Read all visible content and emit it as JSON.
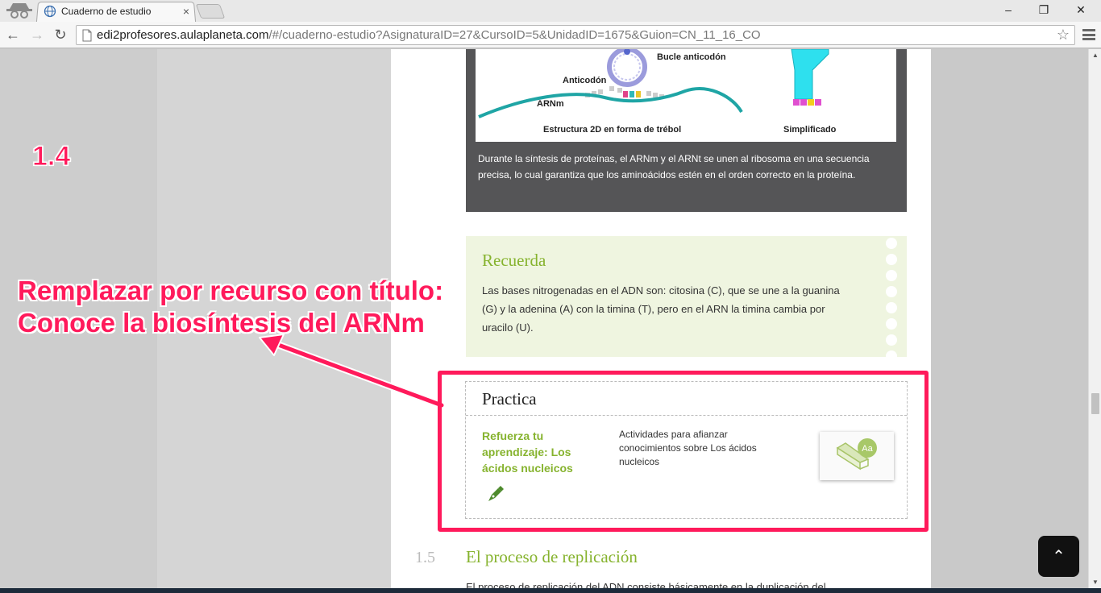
{
  "browser": {
    "tab_title": "Cuaderno de estudio",
    "url_host": "edi2profesores.aulaplaneta.com",
    "url_path": "/#/cuaderno-estudio?AsignaturaID=27&CursoID=5&UnidadID=1675&Guion=CN_11_16_CO",
    "minimize": "–",
    "restore": "❐",
    "close": "✕",
    "back": "←",
    "forward": "→",
    "reload": "↻",
    "bookmark": "☆"
  },
  "figure": {
    "labels": {
      "bucle": "Bucle anticodón",
      "anticodon": "Anticodón",
      "arnm": "ARNm",
      "estructura": "Estructura 2D en forma de trébol",
      "simplificado": "Simplificado"
    },
    "caption": "Durante la síntesis de proteínas, el ARNm y el ARNt se unen al ribosoma en una secuencia precisa, lo cual garantiza que los aminoácidos estén en el orden correcto en la proteína."
  },
  "recuerda": {
    "title": "Recuerda",
    "text": "Las bases nitrogenadas en el ADN son: citosina (C), que se une a la guanina (G) y la adenina (A) con la timina (T), pero en el ARN la timina cambia por uracilo (U)."
  },
  "practica": {
    "title": "Practica",
    "link": "Refuerza tu aprendizaje: Los ácidos nucleicos",
    "description": "Actividades para afianzar conocimientos sobre Los ácidos nucleicos",
    "thumb_badge": "Aa"
  },
  "section": {
    "number": "1.5",
    "title": "El proceso de replicación",
    "body_start": "El proceso de replicación del ADN consiste básicamente en la duplicación del"
  },
  "annotation": {
    "number": "1.4",
    "line1": "Remplazar por recurso con título:",
    "line2": "Conoce la biosíntesis del ARNm",
    "color": "#ff1a5b"
  },
  "scroll_top": "⌃",
  "accent_color": "#86b32e"
}
